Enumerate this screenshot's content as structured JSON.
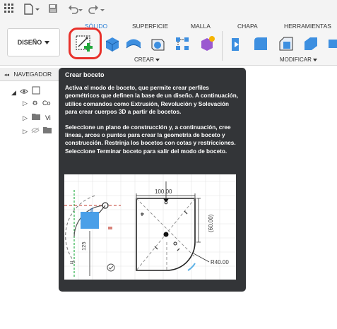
{
  "ribbon": {
    "workspace_label": "DISEÑO",
    "tabs": [
      "SÓLIDO",
      "SUPERFICIE",
      "MALLA",
      "CHAPA",
      "HERRAMIENTAS"
    ],
    "groups": {
      "create": "CREAR",
      "modify": "MODIFICAR"
    }
  },
  "browser": {
    "title": "NAVEGADOR",
    "items": [
      "Co",
      "Vi"
    ]
  },
  "tooltip": {
    "title": "Crear boceto",
    "paragraph1": "Activa el modo de boceto, que permite crear perfiles geométricos que definen la base de un diseño. A continuación, utilice comandos como Extrusión, Revolución y Solevación para crear cuerpos 3D a partir de bocetos.",
    "paragraph2": "Seleccione un plano de construcción y, a continuación, cree líneas, arcos o puntos para crear la geometría de boceto y construcción. Restrinja los bocetos con cotas y restricciones. Seleccione Terminar boceto para salir del modo de boceto.",
    "illustration": {
      "dim_width": "100.00",
      "dim_height": "(60.00)",
      "dim_radius": "R40.00",
      "dim_side": "125"
    }
  },
  "colors": {
    "accent": "#2a7fd4",
    "highlight": "#e8302a",
    "tooltip_bg": "#333538"
  }
}
